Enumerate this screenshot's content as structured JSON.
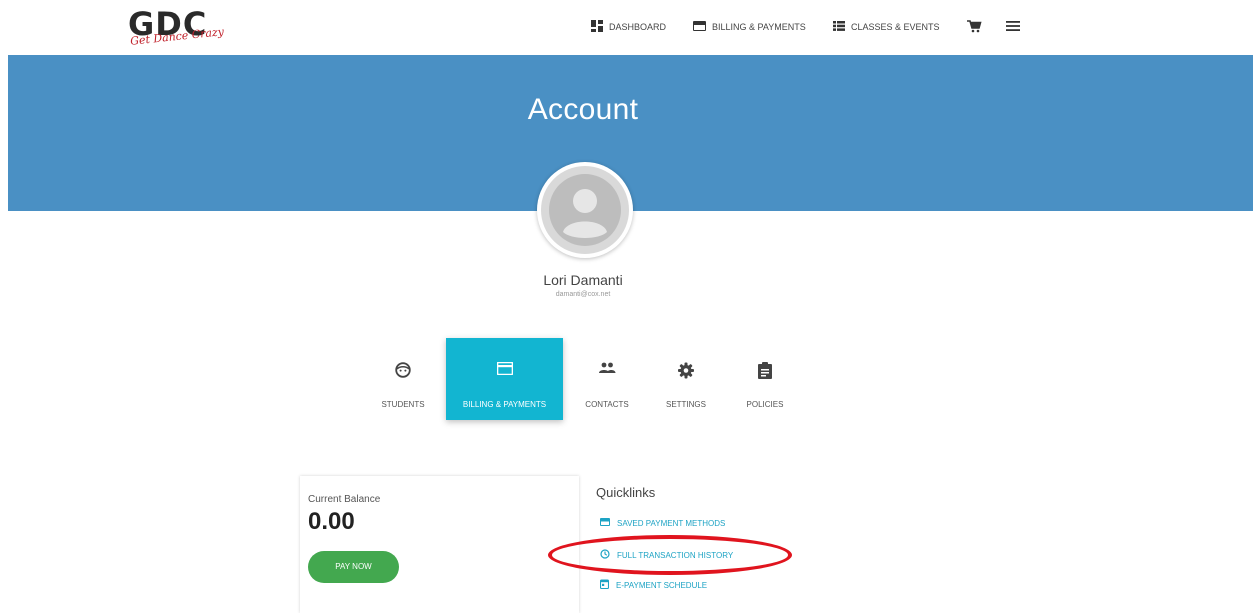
{
  "logo": {
    "text": "GDC",
    "tagline": "Get Dance Crazy"
  },
  "nav": {
    "items": [
      {
        "label": "DASHBOARD",
        "icon": "dashboard-icon"
      },
      {
        "label": "BILLING & PAYMENTS",
        "icon": "credit-card-icon"
      },
      {
        "label": "CLASSES & EVENTS",
        "icon": "list-icon"
      }
    ],
    "cart_icon": "cart-icon",
    "menu_icon": "hamburger-menu-icon"
  },
  "banner": {
    "title": "Account",
    "color": "#4a90c4"
  },
  "profile": {
    "name": "Lori Damanti",
    "email": "damanti@cox.net"
  },
  "tabs": [
    {
      "label": "STUDENTS",
      "icon": "face-icon"
    },
    {
      "label": "BILLING & PAYMENTS",
      "icon": "credit-card-icon",
      "active": true
    },
    {
      "label": "CONTACTS",
      "icon": "people-icon"
    },
    {
      "label": "SETTINGS",
      "icon": "gear-icon"
    },
    {
      "label": "POLICIES",
      "icon": "clipboard-icon"
    }
  ],
  "balance": {
    "label": "Current Balance",
    "value": "0.00",
    "pay_label": "PAY NOW"
  },
  "quicklinks": {
    "title": "Quicklinks",
    "links": [
      {
        "label": "SAVED PAYMENT METHODS",
        "icon": "credit-card-icon"
      },
      {
        "label": "FULL TRANSACTION HISTORY",
        "icon": "history-icon"
      },
      {
        "label": "E-PAYMENT SCHEDULE",
        "icon": "calendar-icon"
      }
    ]
  },
  "colors": {
    "accent": "#12b5d1",
    "link": "#1da3c4",
    "pay": "#43a84f",
    "highlight": "#e0141e"
  }
}
